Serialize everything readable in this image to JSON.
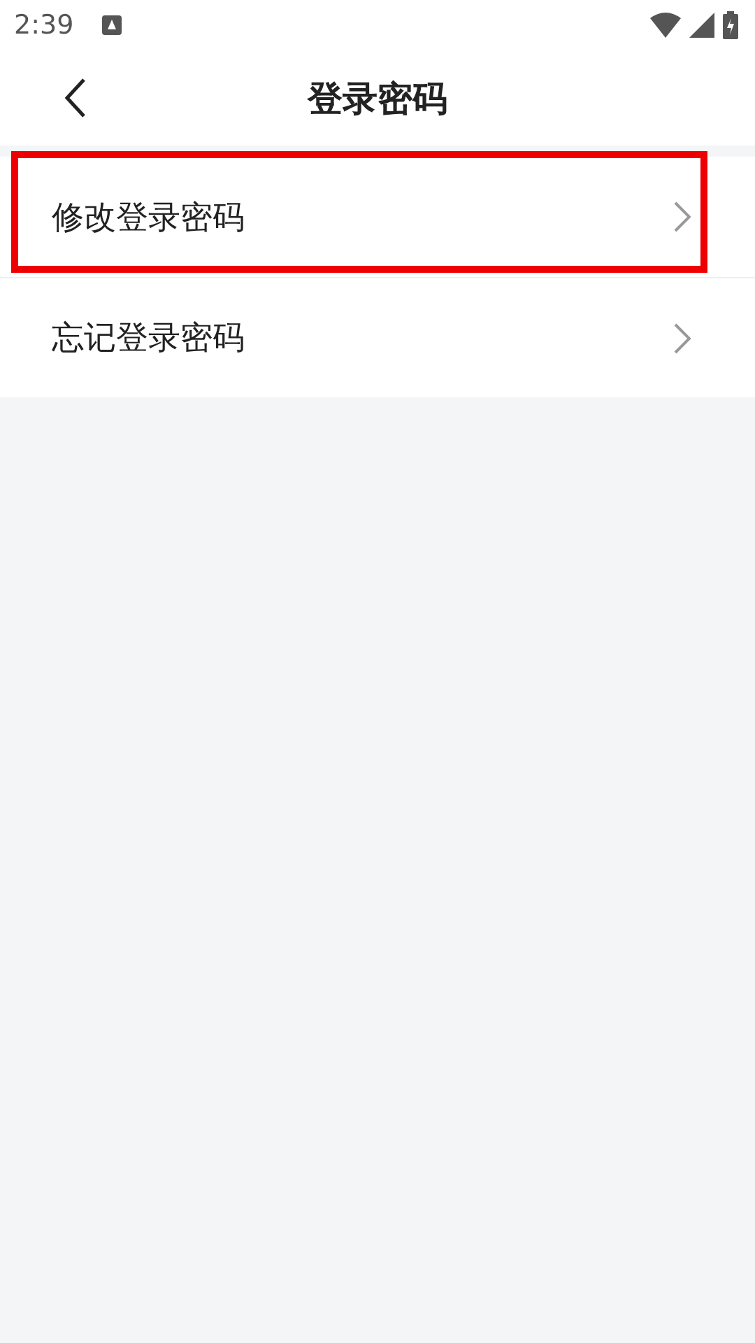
{
  "status_bar": {
    "time": "2:39"
  },
  "header": {
    "title": "登录密码"
  },
  "items": [
    {
      "label": "修改登录密码",
      "highlighted": true
    },
    {
      "label": "忘记登录密码",
      "highlighted": false
    }
  ]
}
